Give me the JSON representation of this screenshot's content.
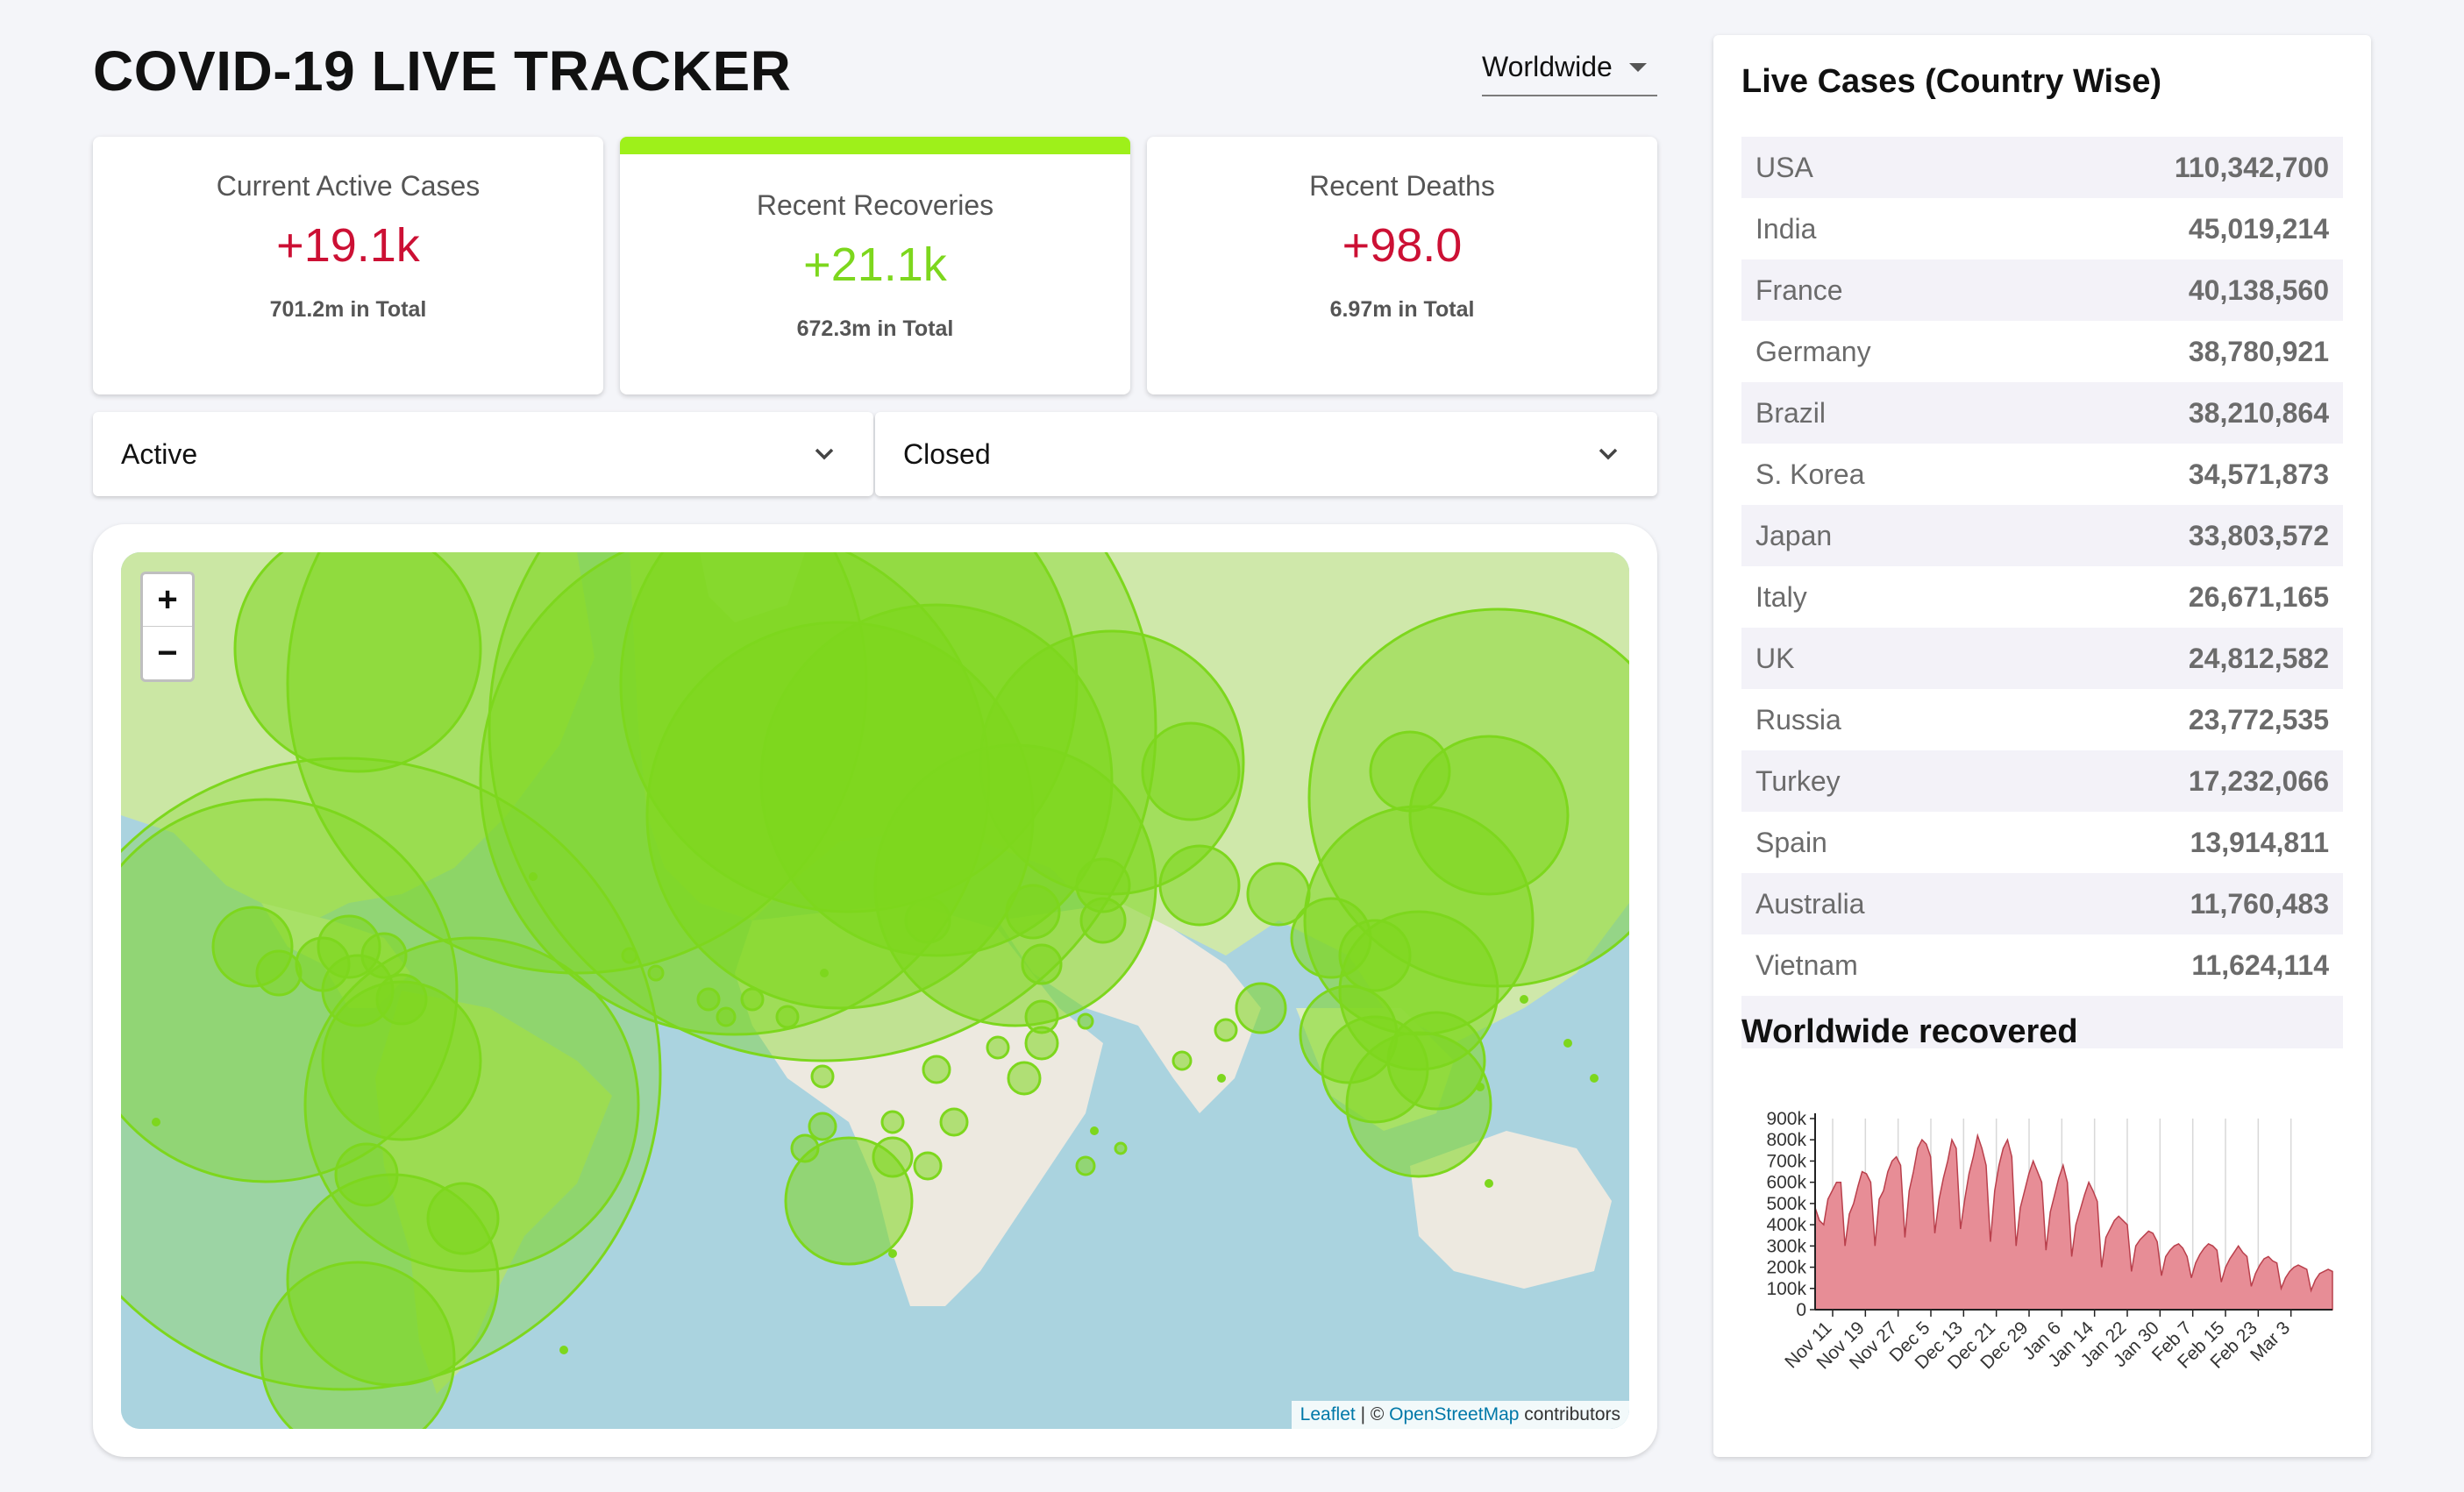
{
  "header": {
    "title": "COVID-19 LIVE TRACKER",
    "country": "Worldwide"
  },
  "cards": [
    {
      "label": "Current Active Cases",
      "value": "+19.1k",
      "total": "701.2m in Total"
    },
    {
      "label": "Recent Recoveries",
      "value": "+21.1k",
      "total": "672.3m in Total"
    },
    {
      "label": "Recent Deaths",
      "value": "+98.0",
      "total": "6.97m in Total"
    }
  ],
  "filters": {
    "left": "Active",
    "right": "Closed"
  },
  "map": {
    "zoom_in": "+",
    "zoom_out": "−",
    "attribution": {
      "leaflet": "Leaflet",
      "sep": " | © ",
      "osm": "OpenStreetMap",
      "contributors": " contributors"
    }
  },
  "sidebar": {
    "title": "Live Cases (Country Wise)",
    "rows": [
      {
        "country": "USA",
        "cases": "110,342,700"
      },
      {
        "country": "India",
        "cases": "45,019,214"
      },
      {
        "country": "France",
        "cases": "40,138,560"
      },
      {
        "country": "Germany",
        "cases": "38,780,921"
      },
      {
        "country": "Brazil",
        "cases": "38,210,864"
      },
      {
        "country": "S. Korea",
        "cases": "34,571,873"
      },
      {
        "country": "Japan",
        "cases": "33,803,572"
      },
      {
        "country": "Italy",
        "cases": "26,671,165"
      },
      {
        "country": "UK",
        "cases": "24,812,582"
      },
      {
        "country": "Russia",
        "cases": "23,772,535"
      },
      {
        "country": "Turkey",
        "cases": "17,232,066"
      },
      {
        "country": "Spain",
        "cases": "13,914,811"
      },
      {
        "country": "Australia",
        "cases": "11,760,483"
      },
      {
        "country": "Vietnam",
        "cases": "11,624,114"
      },
      {
        "country": "",
        "cases": ""
      }
    ],
    "graph_title": "Worldwide recovered"
  },
  "colors": {
    "active": "#cc1034",
    "recovered": "#7dd71d",
    "accent": "#9ef01a",
    "chart_fill": "#e78d96",
    "chart_line": "#b9404c"
  },
  "chart_data": {
    "type": "area",
    "title": "Worldwide recovered",
    "y_ticks": [
      "0",
      "100k",
      "200k",
      "300k",
      "400k",
      "500k",
      "600k",
      "700k",
      "800k",
      "900k"
    ],
    "x_ticks": [
      "Nov 11",
      "Nov 19",
      "Nov 27",
      "Dec 5",
      "Dec 13",
      "Dec 21",
      "Dec 29",
      "Jan 6",
      "Jan 14",
      "Jan 22",
      "Jan 30",
      "Feb 7",
      "Feb 15",
      "Feb 23",
      "Mar 3"
    ],
    "ylim": [
      0,
      900000
    ],
    "values": [
      480000,
      420000,
      400000,
      520000,
      560000,
      600000,
      600000,
      300000,
      450000,
      500000,
      580000,
      650000,
      640000,
      600000,
      300000,
      520000,
      560000,
      650000,
      700000,
      720000,
      680000,
      340000,
      560000,
      650000,
      760000,
      800000,
      780000,
      720000,
      360000,
      520000,
      620000,
      700000,
      800000,
      760000,
      380000,
      520000,
      640000,
      720000,
      820000,
      760000,
      680000,
      320000,
      560000,
      680000,
      760000,
      800000,
      720000,
      300000,
      480000,
      560000,
      640000,
      700000,
      650000,
      600000,
      280000,
      460000,
      540000,
      620000,
      680000,
      600000,
      250000,
      400000,
      470000,
      540000,
      600000,
      560000,
      510000,
      200000,
      340000,
      380000,
      420000,
      440000,
      420000,
      400000,
      180000,
      300000,
      330000,
      350000,
      370000,
      360000,
      320000,
      160000,
      250000,
      280000,
      300000,
      310000,
      290000,
      250000,
      150000,
      220000,
      260000,
      290000,
      310000,
      300000,
      280000,
      130000,
      200000,
      240000,
      270000,
      300000,
      270000,
      250000,
      110000,
      170000,
      210000,
      240000,
      250000,
      230000,
      220000,
      100000,
      150000,
      180000,
      200000,
      210000,
      200000,
      190000,
      90000,
      140000,
      170000,
      180000,
      190000,
      180000
    ]
  }
}
